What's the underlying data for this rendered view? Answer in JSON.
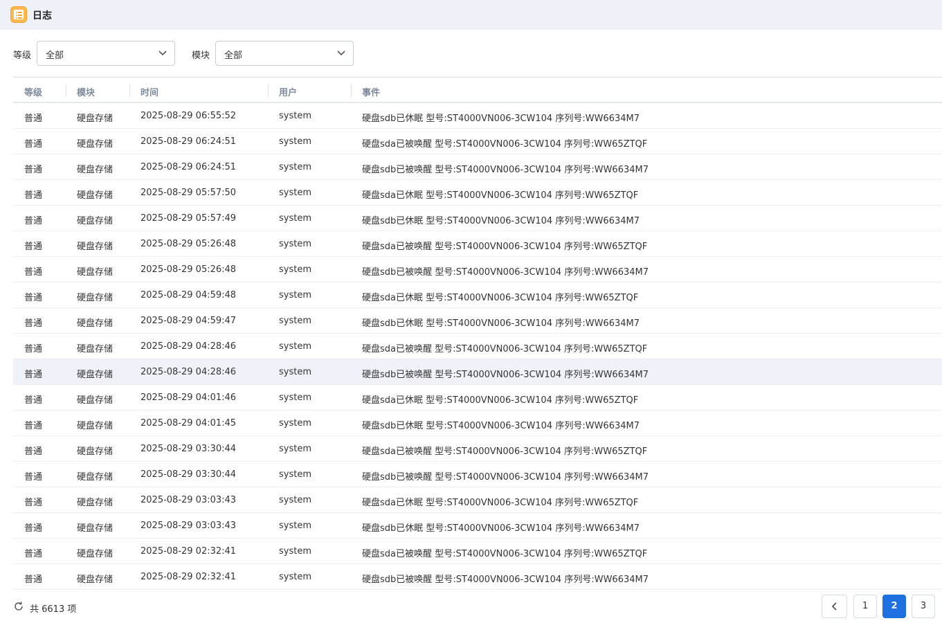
{
  "window": {
    "title": "日志"
  },
  "filters": {
    "level": {
      "label": "等级",
      "value": "全部"
    },
    "module": {
      "label": "模块",
      "value": "全部"
    }
  },
  "table": {
    "columns": [
      "等级",
      "模块",
      "时间",
      "用户",
      "事件"
    ],
    "highlighted_row": 10,
    "rows": [
      [
        "普通",
        "硬盘存储",
        "2025-08-29 06:55:52",
        "system",
        "硬盘sdb已休眠 型号:ST4000VN006-3CW104 序列号:WW6634M7"
      ],
      [
        "普通",
        "硬盘存储",
        "2025-08-29 06:24:51",
        "system",
        "硬盘sda已被唤醒 型号:ST4000VN006-3CW104 序列号:WW65ZTQF"
      ],
      [
        "普通",
        "硬盘存储",
        "2025-08-29 06:24:51",
        "system",
        "硬盘sdb已被唤醒 型号:ST4000VN006-3CW104 序列号:WW6634M7"
      ],
      [
        "普通",
        "硬盘存储",
        "2025-08-29 05:57:50",
        "system",
        "硬盘sda已休眠 型号:ST4000VN006-3CW104 序列号:WW65ZTQF"
      ],
      [
        "普通",
        "硬盘存储",
        "2025-08-29 05:57:49",
        "system",
        "硬盘sdb已休眠 型号:ST4000VN006-3CW104 序列号:WW6634M7"
      ],
      [
        "普通",
        "硬盘存储",
        "2025-08-29 05:26:48",
        "system",
        "硬盘sda已被唤醒 型号:ST4000VN006-3CW104 序列号:WW65ZTQF"
      ],
      [
        "普通",
        "硬盘存储",
        "2025-08-29 05:26:48",
        "system",
        "硬盘sdb已被唤醒 型号:ST4000VN006-3CW104 序列号:WW6634M7"
      ],
      [
        "普通",
        "硬盘存储",
        "2025-08-29 04:59:48",
        "system",
        "硬盘sda已休眠 型号:ST4000VN006-3CW104 序列号:WW65ZTQF"
      ],
      [
        "普通",
        "硬盘存储",
        "2025-08-29 04:59:47",
        "system",
        "硬盘sdb已休眠 型号:ST4000VN006-3CW104 序列号:WW6634M7"
      ],
      [
        "普通",
        "硬盘存储",
        "2025-08-29 04:28:46",
        "system",
        "硬盘sda已被唤醒 型号:ST4000VN006-3CW104 序列号:WW65ZTQF"
      ],
      [
        "普通",
        "硬盘存储",
        "2025-08-29 04:28:46",
        "system",
        "硬盘sdb已被唤醒 型号:ST4000VN006-3CW104 序列号:WW6634M7"
      ],
      [
        "普通",
        "硬盘存储",
        "2025-08-29 04:01:46",
        "system",
        "硬盘sda已休眠 型号:ST4000VN006-3CW104 序列号:WW65ZTQF"
      ],
      [
        "普通",
        "硬盘存储",
        "2025-08-29 04:01:45",
        "system",
        "硬盘sdb已休眠 型号:ST4000VN006-3CW104 序列号:WW6634M7"
      ],
      [
        "普通",
        "硬盘存储",
        "2025-08-29 03:30:44",
        "system",
        "硬盘sda已被唤醒 型号:ST4000VN006-3CW104 序列号:WW65ZTQF"
      ],
      [
        "普通",
        "硬盘存储",
        "2025-08-29 03:30:44",
        "system",
        "硬盘sdb已被唤醒 型号:ST4000VN006-3CW104 序列号:WW6634M7"
      ],
      [
        "普通",
        "硬盘存储",
        "2025-08-29 03:03:43",
        "system",
        "硬盘sda已休眠 型号:ST4000VN006-3CW104 序列号:WW65ZTQF"
      ],
      [
        "普通",
        "硬盘存储",
        "2025-08-29 03:03:43",
        "system",
        "硬盘sdb已休眠 型号:ST4000VN006-3CW104 序列号:WW6634M7"
      ],
      [
        "普通",
        "硬盘存储",
        "2025-08-29 02:32:41",
        "system",
        "硬盘sda已被唤醒 型号:ST4000VN006-3CW104 序列号:WW65ZTQF"
      ],
      [
        "普通",
        "硬盘存储",
        "2025-08-29 02:32:41",
        "system",
        "硬盘sdb已被唤醒 型号:ST4000VN006-3CW104 序列号:WW6634M7"
      ]
    ]
  },
  "footer": {
    "total_text": "共 6613 项",
    "pages": [
      "1",
      "2",
      "3"
    ],
    "current_page": "2"
  },
  "icons": {
    "app": "log-list-icon",
    "refresh": "refresh-icon",
    "prev": "chevron-left-icon",
    "dropdown": "chevron-down-icon"
  },
  "colors": {
    "accent": "#1e6fe0",
    "titlebar_bg": "#eef2f8",
    "header_text": "#7d8a9c",
    "row_highlight": "#eff3f9",
    "app_icon": "#ffb84d"
  }
}
